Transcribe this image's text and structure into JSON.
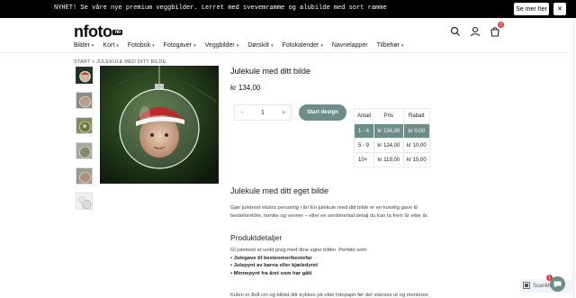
{
  "announcement": {
    "message": "NYHET! Se våre nye premium veggbilder. Lerret med svevemramme og alubilde med sort ramme",
    "more_label": "Se mer her",
    "close_icon": "close-icon"
  },
  "header": {
    "logo_text": "nfoto",
    "logo_suffix": "no",
    "cart_count": "0"
  },
  "nav": {
    "items": [
      {
        "label": "Bilder",
        "has_dropdown": true
      },
      {
        "label": "Kort",
        "has_dropdown": true
      },
      {
        "label": "Fotobok",
        "has_dropdown": true
      },
      {
        "label": "Fotogaver",
        "has_dropdown": true
      },
      {
        "label": "Veggbilder",
        "has_dropdown": true
      },
      {
        "label": "Dørskilt",
        "has_dropdown": true
      },
      {
        "label": "Fotokalender",
        "has_dropdown": true
      },
      {
        "label": "Navnelapper",
        "has_dropdown": false
      },
      {
        "label": "Tilbehør",
        "has_dropdown": true
      }
    ]
  },
  "breadcrumb": {
    "home": "START",
    "separator": "»",
    "current": "JULEKULE MED DITT BILDE"
  },
  "product": {
    "name": "Julekule med ditt bilde",
    "price": "kr 134,00",
    "quantity": "1",
    "minus": "-",
    "plus": "+",
    "start_label": "Start design"
  },
  "price_table": {
    "headers": [
      "Antall",
      "Pris",
      "Rabatt"
    ],
    "rows": [
      {
        "qty": "1 - 4",
        "price": "kr 134,00",
        "discount": "kr 0,00",
        "highlight": true
      },
      {
        "qty": "5 - 9",
        "price": "kr 124,00",
        "discount": "kr 10,00",
        "highlight": false
      },
      {
        "qty": "10+",
        "price": "kr 119,00",
        "discount": "kr 15,00",
        "highlight": false
      }
    ]
  },
  "description": {
    "title": "Julekule med ditt eget bilde",
    "body": "Gjør juletreet ekstra personlig i år! En julekule med ditt bilde er en koselig gave til besteforeldre, familie og venner – eller en sentimental detalj du kan ta frem år etter år."
  },
  "details": {
    "title": "Produktdetaljer",
    "intro": "Gi juletreet et unikt preg med dine egne bilder. Perfekt som:",
    "bullets": [
      "• Julegave til besteomor/bestefar",
      "• Julepynt av barna eller kjæledyret",
      "• Minnepynt fra året som har gått"
    ],
    "cutoff": "Kulen er 8x8 cm og bildet ditt trykkes på ekte fotopapir før det stanses ut og monteres"
  },
  "widgets": {
    "scanner_label": "ScanMe",
    "chat_badge": "1"
  }
}
